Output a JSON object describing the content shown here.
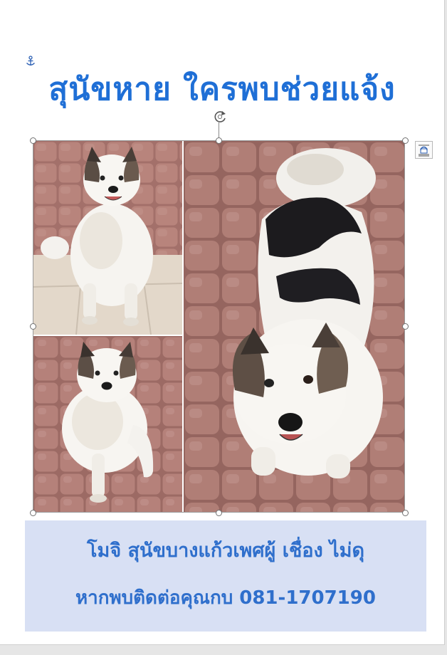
{
  "document": {
    "title": "สุนัขหาย ใครพบช่วยแจ้ง",
    "caption_line_1": "โมจิ สุนัขบางแก้วเพศผู้ เชื่อง ไม่ดุ",
    "caption_line_2": "หากพบติดต่อคุณกบ 081-1707190"
  },
  "icons": {
    "anchor": "anchor-icon",
    "rotate": "rotate-handle-icon",
    "layout_options": "layout-options-icon"
  },
  "colors": {
    "title": "#1f6fd6",
    "caption_text": "#2f6fcc",
    "caption_background": "#d8e0f4"
  }
}
